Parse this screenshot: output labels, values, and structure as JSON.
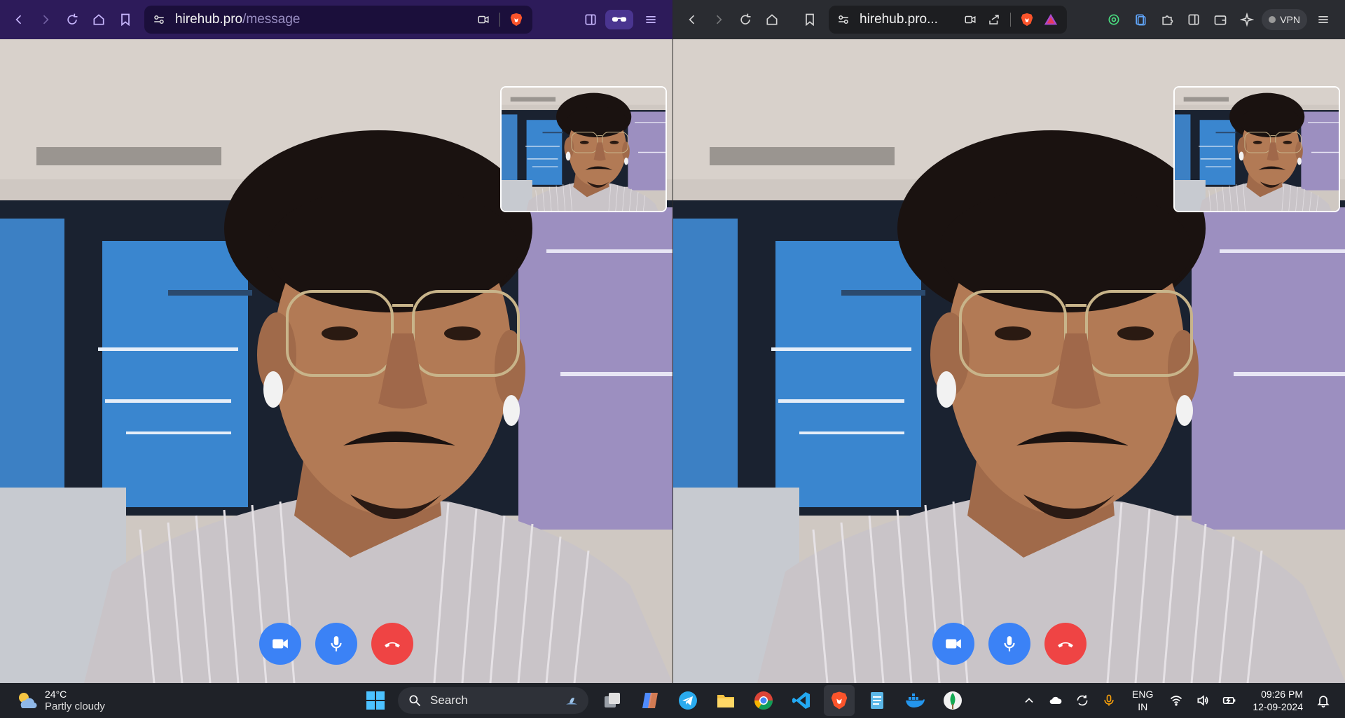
{
  "left_window": {
    "url_domain": "hirehub.pro",
    "url_path": "/message",
    "toolbar_icons": [
      "back-icon",
      "forward-icon",
      "reload-icon",
      "home-icon",
      "bookmark-icon",
      "site-settings-icon",
      "camera-permission-icon",
      "brave-shields-icon",
      "sidebar-icon",
      "private-window-icon",
      "menu-icon"
    ]
  },
  "right_window": {
    "url_display": "hirehub.pro...",
    "vpn_label": "VPN",
    "toolbar_icons": [
      "back-icon",
      "forward-icon",
      "reload-icon",
      "home-icon",
      "bookmark-icon",
      "site-settings-icon",
      "camera-permission-icon",
      "share-icon",
      "brave-shields-icon",
      "brave-rewards-icon",
      "extension-icon",
      "tab-icon",
      "puzzle-icon",
      "sidebar-icon",
      "wallet-icon",
      "leo-ai-icon",
      "menu-icon"
    ]
  },
  "call_controls": [
    "camera-toggle",
    "mic-toggle",
    "end-call"
  ],
  "colors": {
    "left_toolbar": "#2d1b5a",
    "right_toolbar": "#2a2c31",
    "control_blue": "#3b82f6",
    "control_red": "#ef4444",
    "taskbar": "#1f2228"
  },
  "taskbar": {
    "weather_temp": "24°C",
    "weather_condition": "Partly cloudy",
    "search_placeholder": "Search",
    "lang_line1": "ENG",
    "lang_line2": "IN",
    "time": "09:26 PM",
    "date": "12-09-2024",
    "pinned_apps": [
      "windows-start",
      "task-view",
      "copilot",
      "telegram",
      "file-explorer",
      "chrome",
      "vscode",
      "brave",
      "notepad",
      "docker",
      "mongodb-compass"
    ]
  }
}
